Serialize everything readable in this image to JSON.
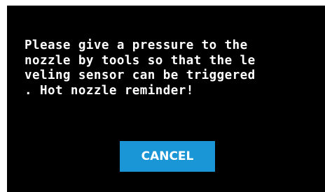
{
  "dialog": {
    "message_lines": [
      "Please give a pressure to the",
      "nozzle by tools so that the le",
      "veling sensor can be triggered",
      ". Hot nozzle reminder!"
    ],
    "cancel_label": "CANCEL"
  },
  "colors": {
    "background": "#000000",
    "text": "#ffffff",
    "button": "#1a95d6"
  }
}
